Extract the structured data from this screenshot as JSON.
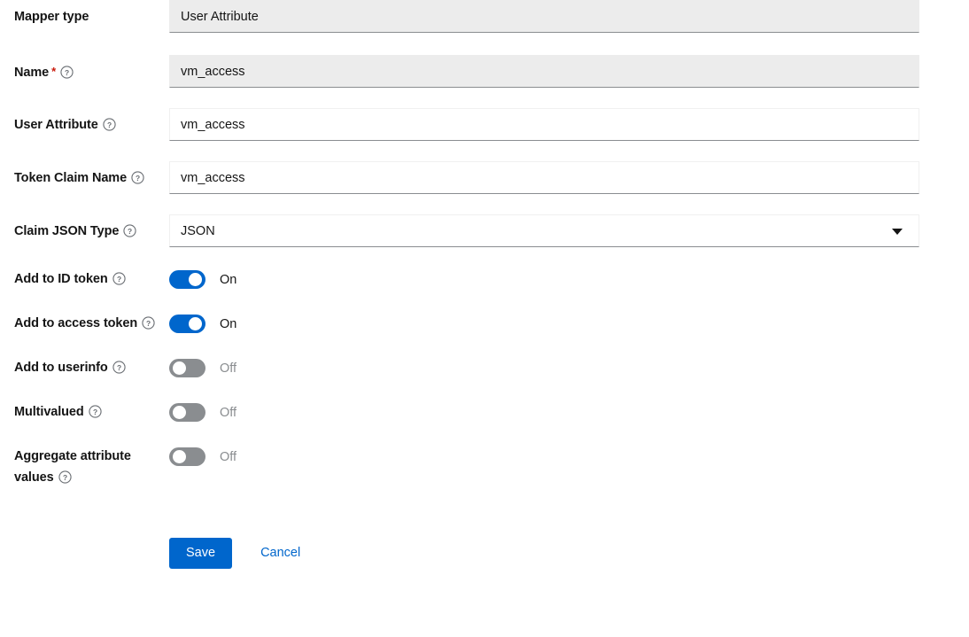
{
  "form": {
    "rows": [
      {
        "label": "Mapper type",
        "required": false,
        "help": false,
        "control": "text",
        "value": "User Attribute",
        "disabled": true
      },
      {
        "label": "Name",
        "required": true,
        "help": true,
        "control": "text",
        "value": "vm_access",
        "disabled": true
      },
      {
        "label": "User Attribute",
        "required": false,
        "help": true,
        "control": "text",
        "value": "vm_access",
        "disabled": false
      },
      {
        "label": "Token Claim Name",
        "required": false,
        "help": true,
        "control": "text",
        "value": "vm_access",
        "disabled": false
      },
      {
        "label": "Claim JSON Type",
        "required": false,
        "help": true,
        "control": "select",
        "value": "JSON"
      },
      {
        "label": "Add to ID token",
        "required": false,
        "help": true,
        "control": "switch",
        "state": "on",
        "state_label": "On"
      },
      {
        "label": "Add to access token",
        "required": false,
        "help": true,
        "control": "switch",
        "state": "on",
        "state_label": "On"
      },
      {
        "label": "Add to userinfo",
        "required": false,
        "help": true,
        "control": "switch",
        "state": "off",
        "state_label": "Off"
      },
      {
        "label": "Multivalued",
        "required": false,
        "help": true,
        "control": "switch",
        "state": "off",
        "state_label": "Off"
      },
      {
        "label": "Aggregate attribute values",
        "required": false,
        "help": true,
        "control": "switch",
        "state": "off",
        "state_label": "Off"
      }
    ],
    "required_marker": "*",
    "help_icon": "help-circle-icon",
    "select_caret_icon": "caret-down-icon",
    "actions": {
      "save_label": "Save",
      "cancel_label": "Cancel"
    },
    "colors": {
      "accent": "#0066cc",
      "switch_off": "#8a8d90",
      "disabled_bg": "#ececec",
      "text": "#151515",
      "required": "#c9190b"
    }
  }
}
